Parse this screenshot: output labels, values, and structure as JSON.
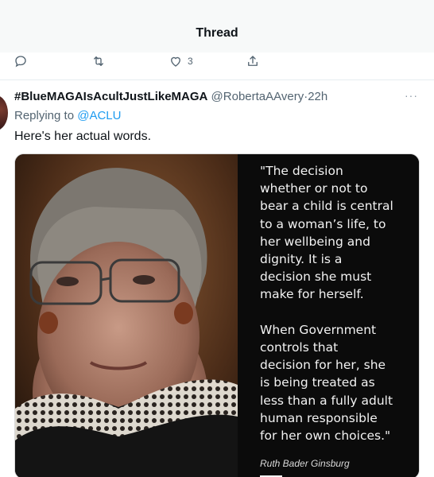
{
  "header": {
    "title": "Thread"
  },
  "previous_tweet_actions": {
    "like_count": "3"
  },
  "tweet": {
    "display_name": "#BlueMAGAIsAcultJustLikeMAGA",
    "handle": "@RobertaAAvery",
    "separator": "·",
    "time": "22h",
    "reply_prefix": "Replying to",
    "reply_target": "@ACLU",
    "text": "Here's her actual words.",
    "more_label": "···",
    "media": {
      "quote": "\"The decision\nwhether or not to\nbear a child is central\nto a woman’s life, to\nher wellbeing and\ndignity. It is a\ndecision she must\nmake for herself.\n\nWhen Government\ncontrols that\ndecision for her, she\nis being treated as\nless than a fully adult\nhuman responsible\nfor her own choices.\"",
      "attribution": "Ruth Bader Ginsburg"
    }
  },
  "icons": {
    "reply": "reply-icon",
    "retweet": "retweet-icon",
    "like": "heart-icon",
    "share": "share-icon"
  },
  "colors": {
    "link": "#1d9bf0",
    "secondary_text": "#536471",
    "header_bg": "#f7f9f9"
  }
}
